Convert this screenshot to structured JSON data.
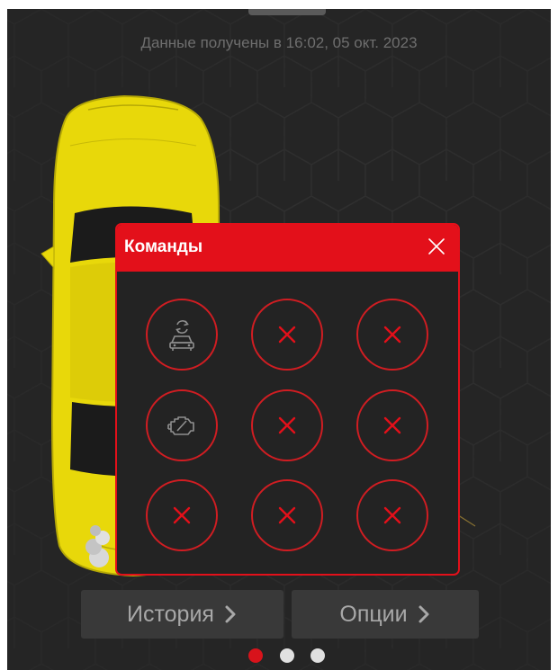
{
  "status": {
    "timestamp": "Данные получены в 16:02, 05 окт. 2023"
  },
  "colors": {
    "accent": "#e3101a",
    "background": "#252525",
    "car": "#e8d80a",
    "inactive_dot": "#e0e0e0"
  },
  "commands_modal": {
    "title": "Команды",
    "close_icon": "close-icon",
    "items": [
      {
        "icon": "remote-start-car-icon",
        "state": "available"
      },
      {
        "icon": "cross-icon",
        "state": "unavailable"
      },
      {
        "icon": "cross-icon",
        "state": "unavailable"
      },
      {
        "icon": "engine-icon",
        "state": "available"
      },
      {
        "icon": "cross-icon",
        "state": "unavailable"
      },
      {
        "icon": "cross-icon",
        "state": "unavailable"
      },
      {
        "icon": "cross-icon",
        "state": "unavailable"
      },
      {
        "icon": "cross-icon",
        "state": "unavailable"
      },
      {
        "icon": "cross-icon",
        "state": "unavailable"
      }
    ]
  },
  "bottom_nav": {
    "history_label": "История",
    "options_label": "Опции",
    "chevron_icon": "chevron-right-icon"
  },
  "pager": {
    "total_pages": 3,
    "active_page": 1
  }
}
